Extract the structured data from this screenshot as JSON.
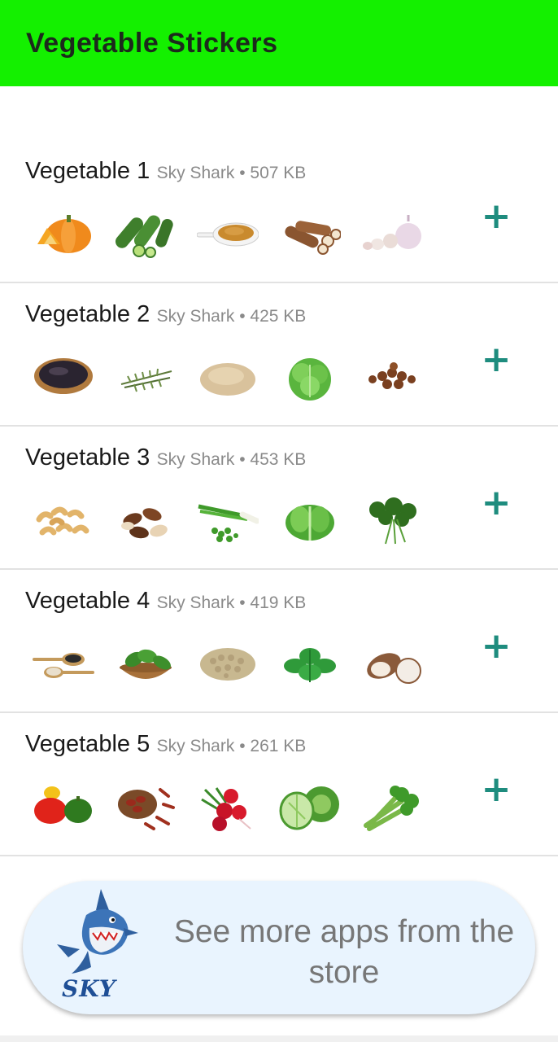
{
  "appbar": {
    "title": "Vegetable Stickers"
  },
  "packs": [
    {
      "name": "Vegetable 1",
      "author": "Sky Shark",
      "size": "507 KB",
      "stickers": [
        "pumpkin",
        "cucumber",
        "spice-spoon",
        "cassava",
        "garlic"
      ]
    },
    {
      "name": "Vegetable 2",
      "author": "Sky Shark",
      "size": "425 KB",
      "stickers": [
        "black-rice-bowl",
        "rosemary",
        "grain-pile",
        "lettuce",
        "chickpeas"
      ]
    },
    {
      "name": "Vegetable 3",
      "author": "Sky Shark",
      "size": "453 KB",
      "stickers": [
        "cashews",
        "brazil-nuts",
        "green-onion",
        "romaine-lettuce",
        "parsley"
      ]
    },
    {
      "name": "Vegetable 4",
      "author": "Sky Shark",
      "size": "419 KB",
      "stickers": [
        "seed-spoons",
        "spinach-bowl",
        "coriander-seeds",
        "mint",
        "taro"
      ]
    },
    {
      "name": "Vegetable 5",
      "author": "Sky Shark",
      "size": "261 KB",
      "stickers": [
        "bell-peppers",
        "dried-chilies",
        "radishes",
        "cabbage",
        "celery"
      ]
    }
  ],
  "separator": "•",
  "add_icon": "plus-icon",
  "store_banner": {
    "text": "See more apps from the store",
    "logo_text": "SKY"
  },
  "colors": {
    "appbar": "#14f000",
    "accent": "#1e8c7e",
    "banner": "#e9f4fe"
  }
}
